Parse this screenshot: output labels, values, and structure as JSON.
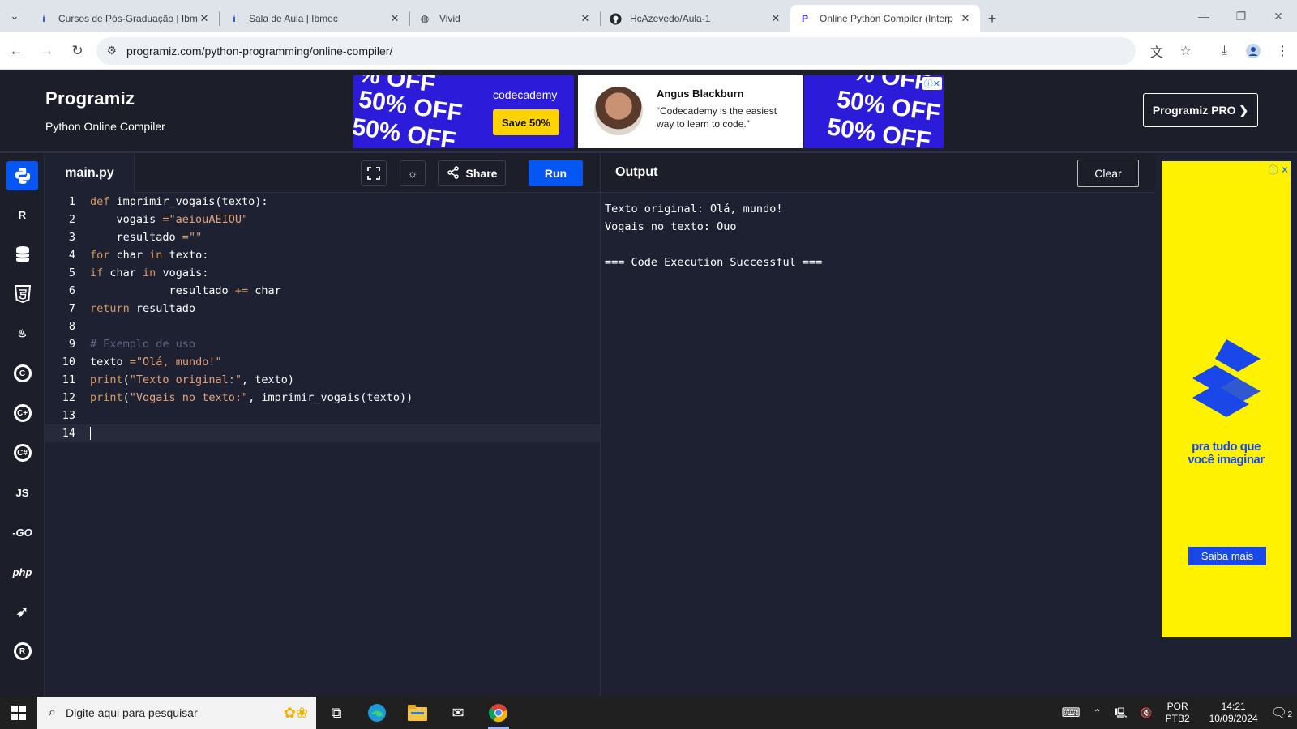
{
  "browser": {
    "tabs": [
      {
        "title": "Cursos de Pós-Graduação | Ibm",
        "active": false
      },
      {
        "title": "Sala de Aula | Ibmec",
        "active": false
      },
      {
        "title": "Vivid",
        "active": false
      },
      {
        "title": "HcAzevedo/Aula-1",
        "active": false
      },
      {
        "title": "Online Python Compiler (Interp",
        "active": true
      }
    ],
    "url": "programiz.com/python-programming/online-compiler/"
  },
  "header": {
    "logo": "Programiz",
    "subtitle": "Python Online Compiler",
    "pro_button": "Programiz PRO ❯"
  },
  "ads": {
    "banner_left": {
      "offer": "50% OFF",
      "offer_partial": "% OFF",
      "brand": "codecademy",
      "cta": "Save 50%"
    },
    "banner_mid": {
      "name": "Angus Blackburn",
      "quote": "“Codecademy is the easiest way to learn to code.”"
    },
    "banner_right": {
      "offer": "50% OFF",
      "offer_partial": "% OFF"
    },
    "side": {
      "tagline_1": "pra tudo que",
      "tagline_2": "você imaginar",
      "cta": "Saiba mais"
    }
  },
  "sidebar": {
    "langs": [
      "Python",
      "R",
      "SQL",
      "HTML",
      "Java",
      "C",
      "C++",
      "C#",
      "JS",
      "GO",
      "php",
      "Swift",
      "Rust"
    ]
  },
  "editor": {
    "filename": "main.py",
    "share_label": "Share",
    "run_label": "Run",
    "lines": [
      "def imprimir_vogais(texto):",
      "    vogais = \"aeiouAEIOU\"",
      "    resultado = \"\"",
      "    for char in texto:",
      "        if char in vogais:",
      "            resultado += char",
      "    return resultado",
      "",
      "# Exemplo de uso",
      "texto = \"Olá, mundo!\"",
      "print(\"Texto original:\", texto)",
      "print(\"Vogais no texto:\", imprimir_vogais(texto))",
      "",
      ""
    ]
  },
  "output": {
    "title": "Output",
    "clear_label": "Clear",
    "lines": [
      "Texto original: Olá, mundo!",
      "Vogais no texto: Ouo",
      "",
      "=== Code Execution Successful ==="
    ]
  },
  "taskbar": {
    "search_placeholder": "Digite aqui para pesquisar",
    "lang_1": "POR",
    "lang_2": "PTB2",
    "time": "14:21",
    "date": "10/09/2024",
    "notif_count": "2"
  },
  "colors": {
    "accent": "#0556f3",
    "bg": "#1e2131",
    "header_bg": "#1c1e2a",
    "ad_blue": "#2c1bd9",
    "ad_yellow": "#fff200"
  }
}
